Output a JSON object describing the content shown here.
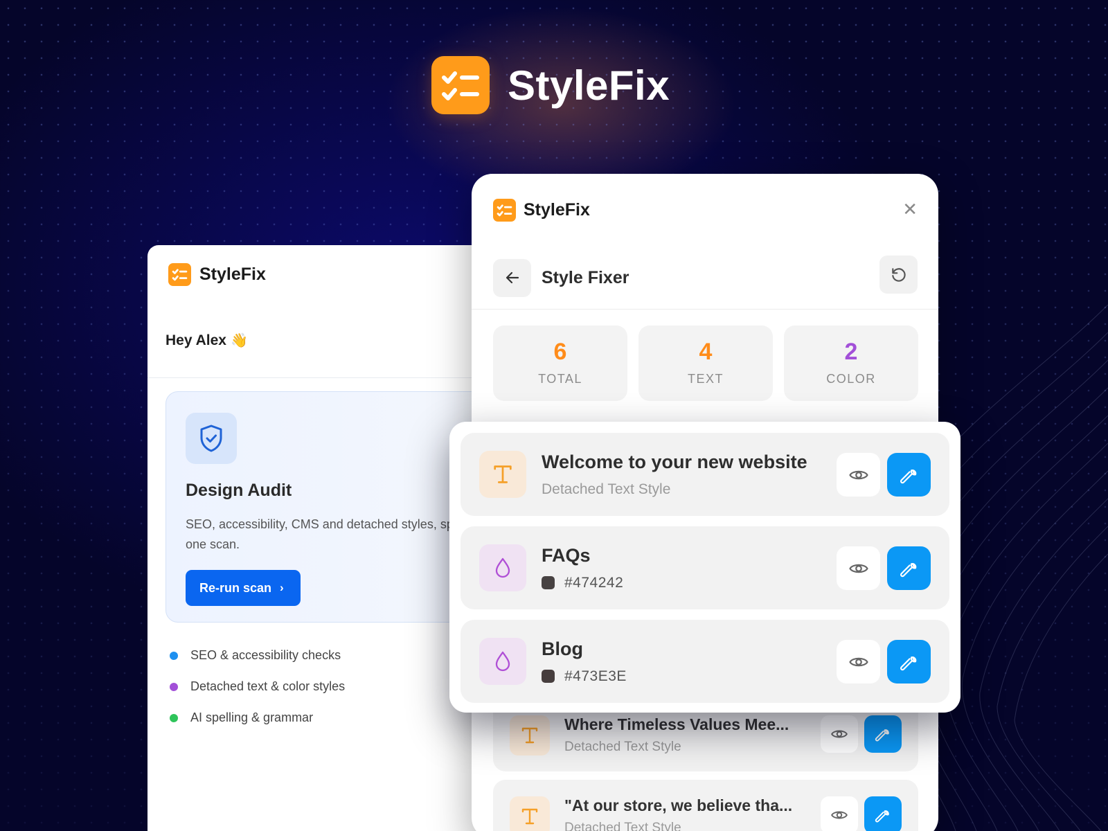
{
  "brand": {
    "name": "StyleFix"
  },
  "colors": {
    "background": "#07063f",
    "brand_orange": "#ff9b1a",
    "primary_blue": "#0a66f0",
    "fix_button_blue": "#0b98f5",
    "text_accent": "#ff9b1a",
    "color_accent": "#b04fd6"
  },
  "back_panel": {
    "brand": "StyleFix",
    "greeting": "Hey Alex",
    "greeting_emoji": "👋",
    "audit_card": {
      "icon": "shield-check-icon",
      "title": "Design Audit",
      "description": "SEO, accessibility, CMS and detached styles, spelling & grammar — all in one scan.",
      "button_label": "Re-run scan",
      "button_icon": "chevron-right-icon"
    },
    "features": [
      {
        "label": "SEO & accessibility checks",
        "color": "#1e90f0"
      },
      {
        "label": "Detached text & color styles",
        "color": "#a24fd8"
      },
      {
        "label": "AI spelling & grammar",
        "color": "#2ec45a"
      }
    ]
  },
  "front_panel": {
    "brand": "StyleFix",
    "close_icon": "close-icon",
    "title": "Style Fixer",
    "back_icon": "arrow-left-icon",
    "reset_icon": "refresh-icon",
    "stats": [
      {
        "value": "6",
        "label": "TOTAL",
        "color": "#ff8c1a"
      },
      {
        "value": "4",
        "label": "TEXT",
        "color": "#ff8c1a"
      },
      {
        "value": "2",
        "label": "COLOR",
        "color": "#a24fd8"
      }
    ],
    "lower_items": [
      {
        "title": "Where Timeless Values Mee...",
        "subtitle": "Detached Text Style",
        "icon": "text-icon"
      },
      {
        "title": "\"At our store, we believe tha...",
        "subtitle": "Detached Text Style",
        "icon": "text-icon"
      }
    ]
  },
  "floating_card": {
    "issues": [
      {
        "type": "text",
        "icon": "text-icon",
        "title": "Welcome to your new website",
        "subtitle": "Detached Text Style",
        "swatch": null
      },
      {
        "type": "color",
        "icon": "drop-icon",
        "title": "FAQs",
        "subtitle": "#474242",
        "swatch": "#474242"
      },
      {
        "type": "color",
        "icon": "drop-icon",
        "title": "Blog",
        "subtitle": "#473E3E",
        "swatch": "#473E3E"
      }
    ]
  }
}
